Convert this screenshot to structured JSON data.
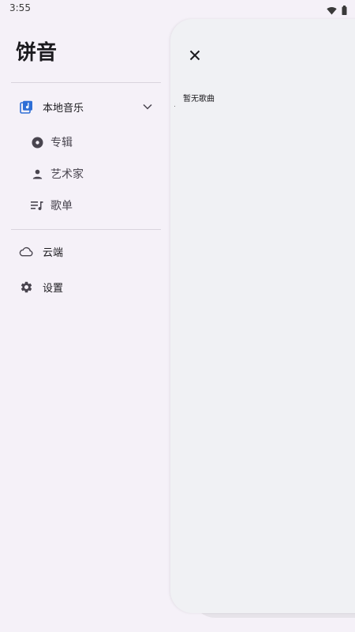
{
  "status_bar": {
    "time": "3:55",
    "icons": [
      "wifi-icon",
      "battery-icon"
    ]
  },
  "drawer": {
    "title": "饼音",
    "local_music": {
      "label": "本地音乐",
      "icon": "music-library-icon",
      "expanded": true,
      "children": [
        {
          "label": "专辑",
          "icon": "album-icon"
        },
        {
          "label": "艺术家",
          "icon": "person-icon"
        },
        {
          "label": "歌单",
          "icon": "playlist-icon"
        }
      ]
    },
    "cloud": {
      "label": "云端",
      "icon": "cloud-icon"
    },
    "settings": {
      "label": "设置",
      "icon": "gear-icon"
    }
  },
  "sheet": {
    "empty_text": "暂无歌曲",
    "close_icon": "close-icon"
  },
  "colors": {
    "background": "#f5f1f8",
    "sheet_background": "#f0f1f4",
    "accent": "#2f6fd6"
  }
}
